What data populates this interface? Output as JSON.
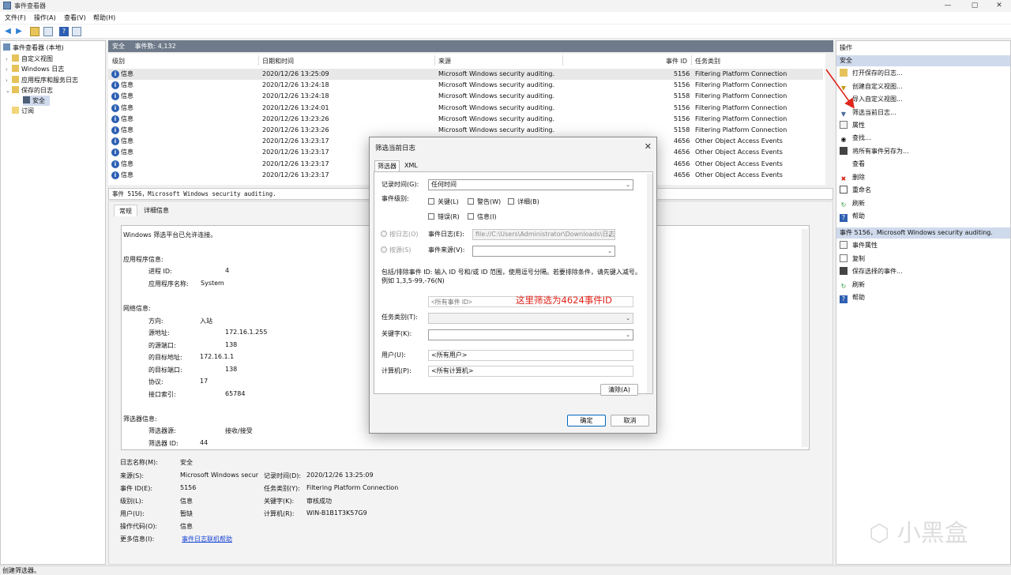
{
  "window": {
    "title": "事件查看器",
    "controls": [
      "—",
      "▢",
      "✕"
    ]
  },
  "menu": [
    "文件(F)",
    "操作(A)",
    "查看(V)",
    "帮助(H)"
  ],
  "tree": {
    "root": "事件查看器 (本地)",
    "items": [
      "自定义视图",
      "Windows 日志",
      "应用程序和服务日志",
      "保存的日志",
      "安全",
      "订阅"
    ]
  },
  "center": {
    "header_title": "安全",
    "header_count": "事件数: 4,132",
    "columns": [
      "级别",
      "日期和时间",
      "来源",
      "事件 ID",
      "任务类别"
    ],
    "rows": [
      {
        "level": "信息",
        "datetime": "2020/12/26 13:25:09",
        "source": "Microsoft Windows security auditing.",
        "id": "5156",
        "category": "Filtering Platform Connection"
      },
      {
        "level": "信息",
        "datetime": "2020/12/26 13:24:18",
        "source": "Microsoft Windows security auditing.",
        "id": "5156",
        "category": "Filtering Platform Connection"
      },
      {
        "level": "信息",
        "datetime": "2020/12/26 13:24:18",
        "source": "Microsoft Windows security auditing.",
        "id": "5158",
        "category": "Filtering Platform Connection"
      },
      {
        "level": "信息",
        "datetime": "2020/12/26 13:24:01",
        "source": "Microsoft Windows security auditing.",
        "id": "5156",
        "category": "Filtering Platform Connection"
      },
      {
        "level": "信息",
        "datetime": "2020/12/26 13:23:26",
        "source": "Microsoft Windows security auditing.",
        "id": "5156",
        "category": "Filtering Platform Connection"
      },
      {
        "level": "信息",
        "datetime": "2020/12/26 13:23:26",
        "source": "Microsoft Windows security auditing.",
        "id": "5158",
        "category": "Filtering Platform Connection"
      },
      {
        "level": "信息",
        "datetime": "2020/12/26 13:23:17",
        "source": "",
        "id": "4656",
        "category": "Other Object Access Events"
      },
      {
        "level": "信息",
        "datetime": "2020/12/26 13:23:17",
        "source": "",
        "id": "4656",
        "category": "Other Object Access Events"
      },
      {
        "level": "信息",
        "datetime": "2020/12/26 13:23:17",
        "source": "",
        "id": "4656",
        "category": "Other Object Access Events"
      },
      {
        "level": "信息",
        "datetime": "2020/12/26 13:23:17",
        "source": "",
        "id": "4656",
        "category": "Other Object Access Events"
      }
    ]
  },
  "detail": {
    "title": "事件 5156，Microsoft Windows security auditing.",
    "tabs": [
      "常规",
      "详细信息"
    ],
    "desc_lines": [
      {
        "t": "Windows 筛选平台已允许连接。",
        "k": ""
      },
      {
        "t": "应用程序信息:",
        "k": ""
      },
      {
        "t": "进程 ID:",
        "k": "4"
      },
      {
        "t": "应用程序名称:",
        "k": "System"
      },
      {
        "t": "网络信息:",
        "k": ""
      },
      {
        "t": "方向:",
        "k": "入站"
      },
      {
        "t": "源地址:",
        "k": "172.16.1.255"
      },
      {
        "t": "的源端口:",
        "k": "138"
      },
      {
        "t": "的目标地址:",
        "k": "172.16.1.1"
      },
      {
        "t": "的目标端口:",
        "k": "138"
      },
      {
        "t": "协议:",
        "k": "17"
      },
      {
        "t": "接口索引:",
        "k": "65784"
      },
      {
        "t": "筛选器信息:",
        "k": ""
      },
      {
        "t": "筛选器源:",
        "k": "接收/接受"
      },
      {
        "t": "筛选器 ID:",
        "k": "44"
      }
    ],
    "fields": {
      "log_name_label": "日志名称(M):",
      "log_name": "安全",
      "source_label": "来源(S):",
      "source": "Microsoft Windows secur",
      "logged_label": "记录时间(D):",
      "logged": "2020/12/26 13:25:09",
      "event_id_label": "事件 ID(E):",
      "event_id": "5156",
      "task_label": "任务类别(Y):",
      "task": "Filtering Platform Connection",
      "level_label": "级别(L):",
      "level": "信息",
      "keywords_label": "关键字(K):",
      "keywords": "审核成功",
      "user_label": "用户(U):",
      "user": "暂缺",
      "computer_label": "计算机(R):",
      "computer": "WIN-B1B1T3K57G9",
      "opcode_label": "操作代码(O):",
      "opcode": "信息",
      "more_label": "更多信息(I):",
      "more_link": "事件日志联机帮助"
    }
  },
  "actions": {
    "header": "操作",
    "section1": "安全",
    "items1": [
      "打开保存的日志...",
      "创建自定义视图...",
      "导入自定义视图...",
      "筛选当前日志...",
      "属性",
      "查找...",
      "将所有事件另存为...",
      "查看",
      "删除",
      "重命名",
      "刷新",
      "帮助"
    ],
    "section2": "事件 5156，Microsoft Windows security auditing.",
    "items2": [
      "事件属性",
      "复制",
      "保存选择的事件...",
      "刷新",
      "帮助"
    ]
  },
  "status": "创建筛选器。",
  "dialog": {
    "title": "筛选当前日志",
    "close": "✕",
    "tabs": [
      "筛选器",
      "XML"
    ],
    "logged_label": "记录时间(G):",
    "logged_value": "任何时间",
    "level_label": "事件级别:",
    "levels": [
      "关键(L)",
      "警告(W)",
      "详细(B)",
      "错误(R)",
      "信息(I)"
    ],
    "by_log": "按日志(O)",
    "log_label": "事件日志(E):",
    "log_value": "file://C:\\Users\\Administrator\\Downloads\\日志",
    "by_source": "按源(S)",
    "source_label": "事件来源(V):",
    "hint": "包括/排除事件 ID: 输入 ID 号和/或 ID 范围，使用逗号分隔。若要排除条件，请先键入减号。例如 1,3,5-99,-76(N)",
    "event_id_placeholder": "<所有事件 ID>",
    "task_label": "任务类别(T):",
    "keywords_label": "关键字(K):",
    "user_label": "用户(U):",
    "user_value": "<所有用户>",
    "computer_label": "计算机(P):",
    "computer_value": "<所有计算机>",
    "clear": "清除(A)",
    "ok": "确定",
    "cancel": "取消"
  },
  "annotation": "这里筛选为4624事件ID",
  "colors": {
    "accent": "#0067c0",
    "annotation": "#e0251b",
    "header": "#6f7b8a",
    "section": "#cfdaec"
  }
}
